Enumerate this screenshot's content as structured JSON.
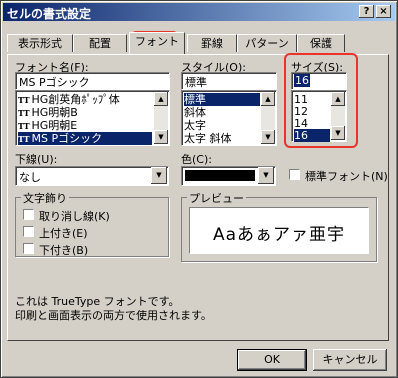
{
  "window": {
    "title": "セルの書式設定",
    "help_glyph": "?",
    "close_glyph": "×"
  },
  "tabs": [
    {
      "label": "表示形式"
    },
    {
      "label": "配置"
    },
    {
      "label": "フォント",
      "active": true
    },
    {
      "label": "罫線"
    },
    {
      "label": "パターン"
    },
    {
      "label": "保護"
    }
  ],
  "font": {
    "label": "フォント名(F):",
    "value": "MS Pゴシック",
    "items": [
      {
        "text": "HG創英角ﾎﾟｯﾌﾟ体",
        "tt": true,
        "selected": false
      },
      {
        "text": "HG明朝B",
        "tt": true,
        "selected": false
      },
      {
        "text": "HG明朝E",
        "tt": true,
        "selected": false
      },
      {
        "text": "MS Pゴシック",
        "tt": true,
        "selected": true
      }
    ]
  },
  "style": {
    "label": "スタイル(O):",
    "value": "標準",
    "items": [
      {
        "text": "標準",
        "selected": true
      },
      {
        "text": "斜体",
        "selected": false
      },
      {
        "text": "太字",
        "selected": false
      },
      {
        "text": "太字 斜体",
        "selected": false
      }
    ]
  },
  "size": {
    "label": "サイズ(S):",
    "value": "16",
    "items": [
      {
        "text": "11",
        "selected": false
      },
      {
        "text": "12",
        "selected": false
      },
      {
        "text": "14",
        "selected": false
      },
      {
        "text": "16",
        "selected": true
      }
    ]
  },
  "underline": {
    "label": "下線(U):",
    "value": "なし"
  },
  "color": {
    "label": "色(C):",
    "swatch": "#000000"
  },
  "normal_font": {
    "label": "標準フォント(N)",
    "checked": false
  },
  "effects": {
    "title": "文字飾り",
    "items": [
      {
        "label": "取り消し線(K)",
        "checked": false
      },
      {
        "label": "上付き(E)",
        "checked": false
      },
      {
        "label": "下付き(B)",
        "checked": false
      }
    ]
  },
  "preview": {
    "title": "プレビュー",
    "sample": "Aaあぁアァ亜宇"
  },
  "info": {
    "line1": "これは TrueType フォントです。",
    "line2": "印刷と画面表示の両方で使用されます。"
  },
  "buttons": {
    "ok": "OK",
    "cancel": "キャンセル"
  },
  "scroll_glyphs": {
    "up": "▲",
    "down": "▼"
  },
  "tt_glyph": "TT",
  "colors": {
    "title_start": "#0a246a",
    "selection": "#0a246a",
    "highlight": "#e8342a"
  }
}
